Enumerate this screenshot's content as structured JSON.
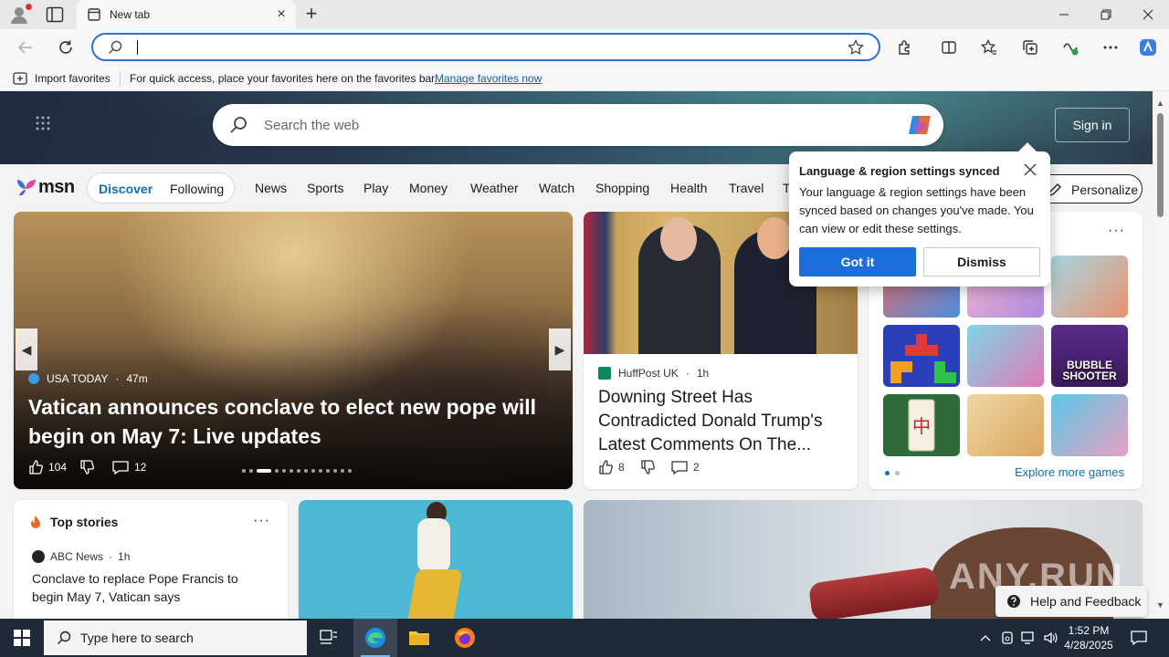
{
  "browser": {
    "tab_title": "New tab",
    "address_value": "",
    "favorites_bar": {
      "import_label": "Import favorites",
      "message": "For quick access, place your favorites here on the favorites bar.",
      "link": "Manage favorites now"
    }
  },
  "msn": {
    "search_placeholder": "Search the web",
    "sign_in": "Sign in",
    "logo_text": "msn",
    "feed_tabs": [
      "Discover",
      "Following"
    ],
    "categories": [
      "News",
      "Sports",
      "Play",
      "Money",
      "Weather",
      "Watch",
      "Shopping",
      "Health",
      "Travel",
      "T"
    ],
    "personalize": "Personalize"
  },
  "hero": {
    "source": "USA TODAY",
    "time": "47m",
    "title": "Vatican announces conclave to elect new pope will begin on May 7: Live updates",
    "likes": "104",
    "comments": "12"
  },
  "news": {
    "source": "HuffPost UK",
    "time": "1h",
    "title": "Downing Street Has Contradicted Donald Trump's Latest Comments On The...",
    "likes": "8",
    "comments": "2"
  },
  "games": {
    "tiles": [
      "",
      "",
      "",
      "",
      "",
      "BUBBLE SHOOTER",
      "",
      "",
      ""
    ],
    "explore_link": "Explore more games"
  },
  "top_stories": {
    "title": "Top stories",
    "source": "ABC News",
    "time": "1h",
    "headline": "Conclave to replace Pope Francis to begin May 7, Vatican says"
  },
  "popup": {
    "title": "Language & region settings synced",
    "body": "Your language & region settings have been synced based on changes you've made. You can view or edit these settings.",
    "primary": "Got it",
    "secondary": "Dismiss"
  },
  "help_feedback": "Help and Feedback",
  "watermark": "ANY.RUN",
  "taskbar": {
    "search_placeholder": "Type here to search",
    "time": "1:52 PM",
    "date": "4/28/2025"
  }
}
